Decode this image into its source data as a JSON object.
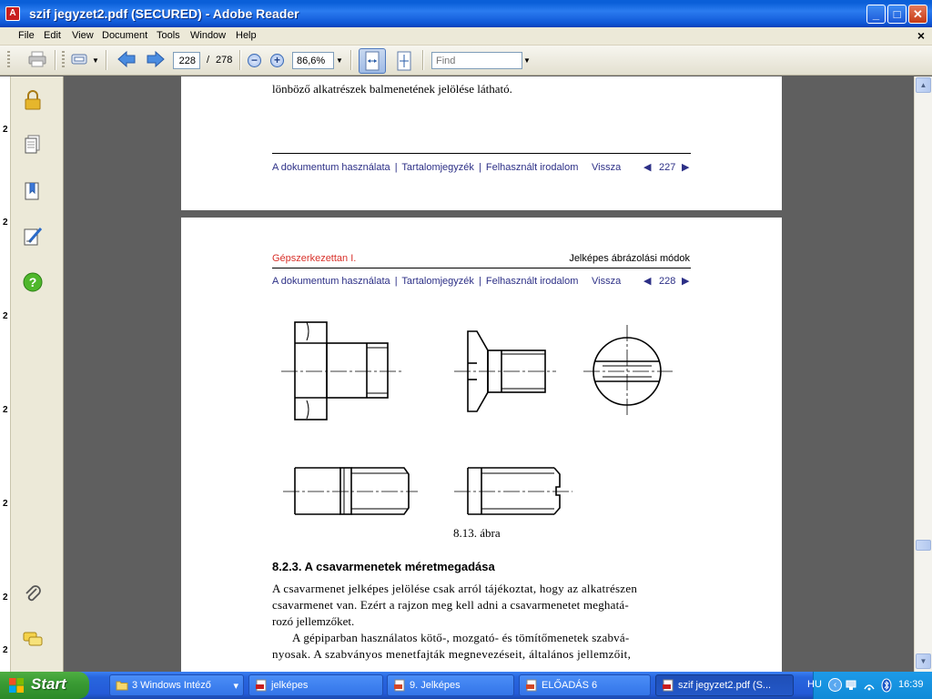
{
  "window": {
    "title": "szif jegyzet2.pdf (SECURED) - Adobe Reader",
    "minimize": "_",
    "maximize": "□",
    "close": "✕"
  },
  "menu": [
    "File",
    "Edit",
    "View",
    "Document",
    "Tools",
    "Window",
    "Help"
  ],
  "menu_close": "×",
  "toolbar": {
    "page_current": "228",
    "page_separator": "/",
    "page_total": "278",
    "zoom": "86,6%",
    "find_placeholder": "Find"
  },
  "nav_strip_numbers": [
    "2",
    "2",
    "2",
    "2",
    "2",
    "2",
    "2"
  ],
  "page227": {
    "text_line": "lönböző alkatrészek balmenetének jelölése látható.",
    "nav": {
      "link1": "A dokumentum használata",
      "sep": "|",
      "link2": "Tartalomjegyzék",
      "link3": "Felhasznált irodalom",
      "back": "Vissza",
      "page": "227",
      "prev": "◀",
      "next": "▶"
    }
  },
  "page228": {
    "header_left": "Gépszerkezettan I.",
    "header_right": "Jelképes ábrázolási módok",
    "nav": {
      "link1": "A dokumentum használata",
      "sep": "|",
      "link2": "Tartalomjegyzék",
      "link3": "Felhasznált irodalom",
      "back": "Vissza",
      "page": "228",
      "prev": "◀",
      "next": "▶"
    },
    "figure_caption": "8.13. ábra",
    "section_heading": "8.2.3. A csavarmenetek méretmegadása",
    "paragraph1": [
      "A csavarmenet jelképes jelölése csak arról tájékoztat, hogy az alkatrészen",
      "csavarmenet van. Ezért a rajzon meg kell adni a csavarmenetet meghatá-",
      "rozó jellemzőket."
    ],
    "paragraph2": [
      "A gépiparban használatos kötő-, mozgató- és tömítőmenetek szabvá-",
      "nyosak. A szabványos menetfajták megnevezéseit, általános jellemzőit,"
    ]
  },
  "taskbar": {
    "start_label": "Start",
    "tasks": [
      {
        "label": "3 Windows Intéző",
        "arrow": "▾"
      },
      {
        "label": "jelképes"
      },
      {
        "label": "9. Jelképes"
      },
      {
        "label": "ELŐADÁS 6"
      },
      {
        "label": "szif jegyzet2.pdf (S..."
      }
    ],
    "language": "HU",
    "clock": "16:39"
  },
  "colors": {
    "nav_link": "#2c2f86",
    "header_red": "#d8312a",
    "titlebar_blue": "#0a5fd8",
    "taskbar_blue": "#245ad8",
    "start_green": "#3a9c34"
  }
}
